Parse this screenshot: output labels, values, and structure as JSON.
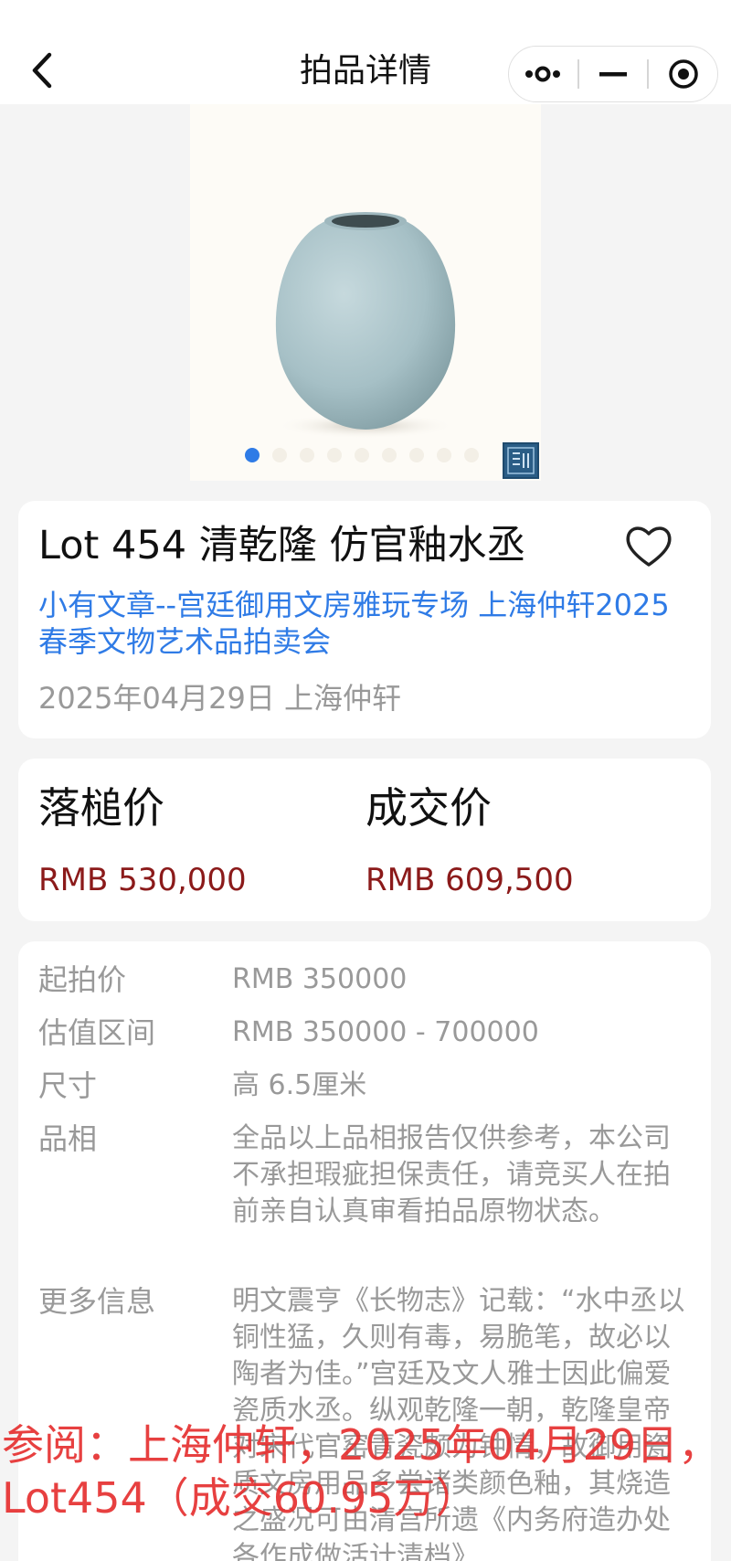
{
  "nav": {
    "title": "拍品详情",
    "back_icon": "chevron-left-icon",
    "more_icon": "more-dots-icon",
    "minimize_icon": "minus-icon",
    "close_icon": "target-circle-icon"
  },
  "gallery": {
    "image_count": 9,
    "active_index": 0,
    "accent_color": "#2f7be6"
  },
  "lot": {
    "title": "Lot 454 清乾隆 仿官釉水丞",
    "session": "小有文章--宫廷御用文房雅玩专场 上海仲轩2025春季文物艺术品拍卖会",
    "meta": "2025年04月29日 上海仲轩",
    "favorite_icon": "heart-outline-icon"
  },
  "prices": {
    "hammer_label": "落槌价",
    "hammer_value": "RMB 530,000",
    "deal_label": "成交价",
    "deal_value": "RMB 609,500",
    "price_color": "#8b1a1a"
  },
  "details": [
    {
      "key": "起拍价",
      "value": "RMB 350000"
    },
    {
      "key": "估值区间",
      "value": "RMB 350000 - 700000"
    },
    {
      "key": "尺寸",
      "value": "高 6.5厘米"
    },
    {
      "key": "品相",
      "value": "全品以上品相报告仅供参考，本公司不承担瑕疵担保责任，请竞买人在拍前亲自认真审看拍品原物状态。"
    },
    {
      "key": "更多信息",
      "value": "明文震亨《长物志》记载：“水中丞以铜性猛，久则有毒，易脆笔，故必以陶者为佳。”宫廷及文人雅士因此偏爱瓷质水丞。纵观乾隆一朝，乾隆皇帝对宋代官窑青瓷颇为钟情，故御用瓷质文房用品多尝诸类颜色釉，其烧造之盛况可由清宫所遗《内务府造办处各作成做活计清档》"
    }
  ],
  "watermark": {
    "line1": "参阅：上海仲轩，2025年04月29日，",
    "line2": "Lot454（成交60.95万）",
    "color": "#e63030"
  }
}
